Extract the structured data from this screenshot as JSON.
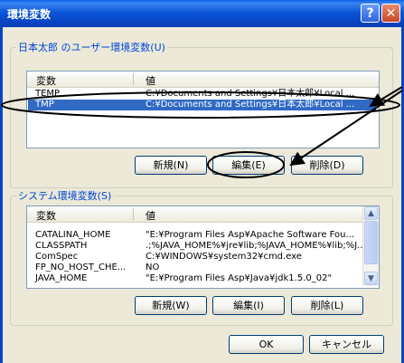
{
  "window": {
    "title": "環境変数",
    "help": "?",
    "close": "✕"
  },
  "user_group": {
    "legend": "日本太郎 のユーザー環境変数(U)",
    "columns": [
      "変数",
      "値"
    ],
    "rows": [
      {
        "name": "TEMP",
        "value": "C:¥Documents and Settings¥日本太郎¥Local ..."
      },
      {
        "name": "TMP",
        "value": "C:¥Documents and Settings¥日本太郎¥Local ..."
      }
    ],
    "selected_index": 1,
    "buttons": {
      "new": "新規(N)",
      "edit": "編集(E)",
      "delete": "削除(D)"
    }
  },
  "system_group": {
    "legend": "システム環境変数(S)",
    "columns": [
      "変数",
      "値"
    ],
    "rows": [
      {
        "name": "CATALINA_HOME",
        "value": "\"E:¥Program Files Asp¥Apache Software Fou..."
      },
      {
        "name": "CLASSPATH",
        "value": ".;%JAVA_HOME%¥jre¥lib;%JAVA_HOME%¥lib;%J..."
      },
      {
        "name": "ComSpec",
        "value": "C:¥WINDOWS¥system32¥cmd.exe"
      },
      {
        "name": "FP_NO_HOST_CHE...",
        "value": "NO"
      },
      {
        "name": "JAVA_HOME",
        "value": "\"E:¥Program Files Asp¥Java¥jdk1.5.0_02\""
      }
    ],
    "buttons": {
      "new": "新規(W)",
      "edit": "編集(I)",
      "delete": "削除(L)"
    },
    "scroll_up": "▲",
    "scroll_down": "▼"
  },
  "dialog_buttons": {
    "ok": "OK",
    "cancel": "キャンセル"
  },
  "colors": {
    "selection": "#316ac5",
    "annotation": "#000000",
    "titlebar": "#0845c4"
  }
}
